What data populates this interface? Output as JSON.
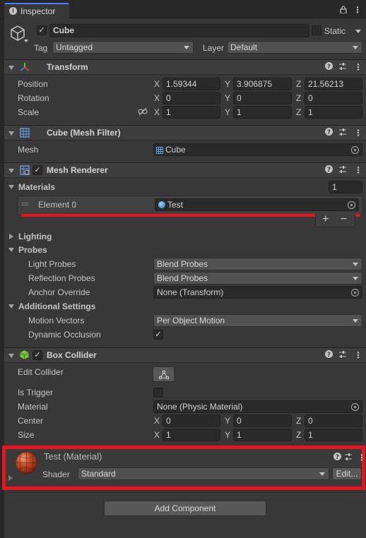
{
  "window": {
    "tab_title": "Inspector",
    "tab_icon": "info-icon"
  },
  "header": {
    "object_name": "Cube",
    "static_label": "Static",
    "tag_label": "Tag",
    "tag_value": "Untagged",
    "layer_label": "Layer",
    "layer_value": "Default"
  },
  "transform": {
    "title": "Transform",
    "position_label": "Position",
    "rotation_label": "Rotation",
    "scale_label": "Scale",
    "axes": [
      "X",
      "Y",
      "Z"
    ],
    "position": [
      "1.59344",
      "3.906875",
      "21.56213"
    ],
    "rotation": [
      "0",
      "0",
      "0"
    ],
    "scale": [
      "1",
      "1",
      "1"
    ]
  },
  "mesh_filter": {
    "title": "Cube (Mesh Filter)",
    "mesh_label": "Mesh",
    "mesh_value": "Cube"
  },
  "mesh_renderer": {
    "title": "Mesh Renderer",
    "materials_label": "Materials",
    "materials_count": "1",
    "element0_label": "Element 0",
    "element0_value": "Test",
    "add_label": "+",
    "remove_label": "−",
    "lighting_label": "Lighting",
    "probes_label": "Probes",
    "light_probes_label": "Light Probes",
    "light_probes_value": "Blend Probes",
    "reflection_probes_label": "Reflection Probes",
    "reflection_probes_value": "Blend Probes",
    "anchor_override_label": "Anchor Override",
    "anchor_override_value": "None (Transform)",
    "additional_settings_label": "Additional Settings",
    "motion_vectors_label": "Motion Vectors",
    "motion_vectors_value": "Per Object Motion",
    "dynamic_occlusion_label": "Dynamic Occlusion"
  },
  "box_collider": {
    "title": "Box Collider",
    "edit_collider_label": "Edit Collider",
    "is_trigger_label": "Is Trigger",
    "material_label": "Material",
    "material_value": "None (Physic Material)",
    "center_label": "Center",
    "size_label": "Size",
    "center": [
      "0",
      "0",
      "0"
    ],
    "size": [
      "1",
      "1",
      "1"
    ]
  },
  "material": {
    "title": "Test (Material)",
    "shader_label": "Shader",
    "shader_value": "Standard",
    "edit_label": "Edit..."
  },
  "add_component_label": "Add Component",
  "colors": {
    "highlight": "#e8141e",
    "panel_bg": "#383838",
    "field_bg": "#2a2a2a",
    "header_bg": "#3e3e3e"
  }
}
